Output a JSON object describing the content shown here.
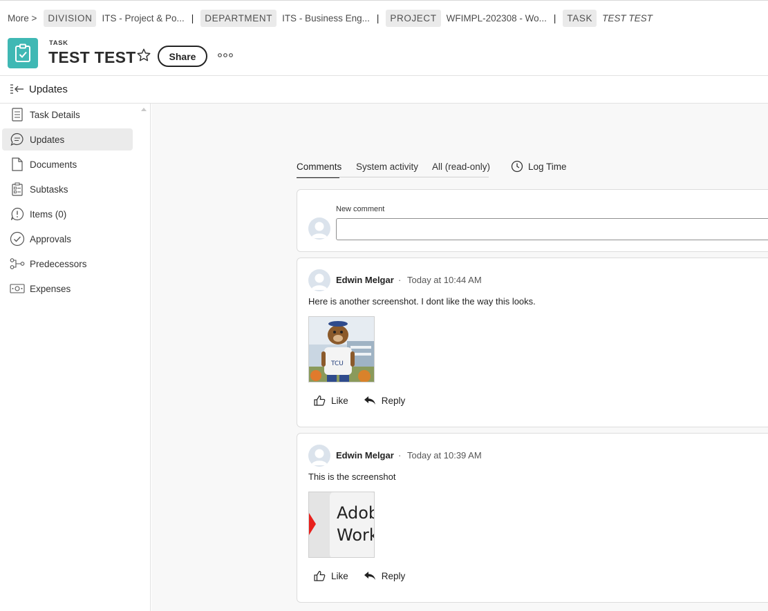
{
  "breadcrumb": {
    "more": "More",
    "more_chevron": ">",
    "items": [
      {
        "chip": "DIVISION",
        "value": "ITS - Project & Po..."
      },
      {
        "chip": "DEPARTMENT",
        "value": "ITS - Business Eng..."
      },
      {
        "chip": "PROJECT",
        "value": "WFIMPL-202308 - Wo..."
      },
      {
        "chip": "TASK",
        "value": "TEST TEST"
      }
    ],
    "separator": "|"
  },
  "header": {
    "object_type": "TASK",
    "title": "TEST TEST",
    "share_label": "Share",
    "icons": [
      "clipboard-icon",
      "star-icon",
      "more-icon"
    ],
    "tile_color": "#3fb8b4"
  },
  "panel": {
    "title": "Updates"
  },
  "sidebar": {
    "items": [
      {
        "label": "Task Details",
        "icon": "task-details-icon"
      },
      {
        "label": "Updates",
        "icon": "updates-icon",
        "active": true
      },
      {
        "label": "Documents",
        "icon": "documents-icon"
      },
      {
        "label": "Subtasks",
        "icon": "subtasks-icon"
      },
      {
        "label": "Items (0)",
        "icon": "items-icon"
      },
      {
        "label": "Approvals",
        "icon": "approvals-icon"
      },
      {
        "label": "Predecessors",
        "icon": "predecessors-icon"
      },
      {
        "label": "Expenses",
        "icon": "expenses-icon"
      }
    ]
  },
  "tabs": [
    {
      "label": "Comments",
      "active": true
    },
    {
      "label": "System activity"
    },
    {
      "label": "All (read-only)"
    }
  ],
  "log_time_label": "Log Time",
  "new_comment": {
    "label": "New comment",
    "value": ""
  },
  "comments": [
    {
      "author": "Edwin Melgar",
      "separator": "·",
      "time": "Today at 10:44 AM",
      "text": "Here is another screenshot.  I dont like the way this looks.",
      "attachment": "mascot-photo",
      "like_label": "Like",
      "reply_label": "Reply"
    },
    {
      "author": "Edwin Melgar",
      "separator": "·",
      "time": "Today at 10:39 AM",
      "text": "This is the screenshot",
      "attachment": "adobe-workfront-screenshot",
      "attachment_text": [
        "Adob",
        "Work"
      ],
      "like_label": "Like",
      "reply_label": "Reply"
    }
  ]
}
